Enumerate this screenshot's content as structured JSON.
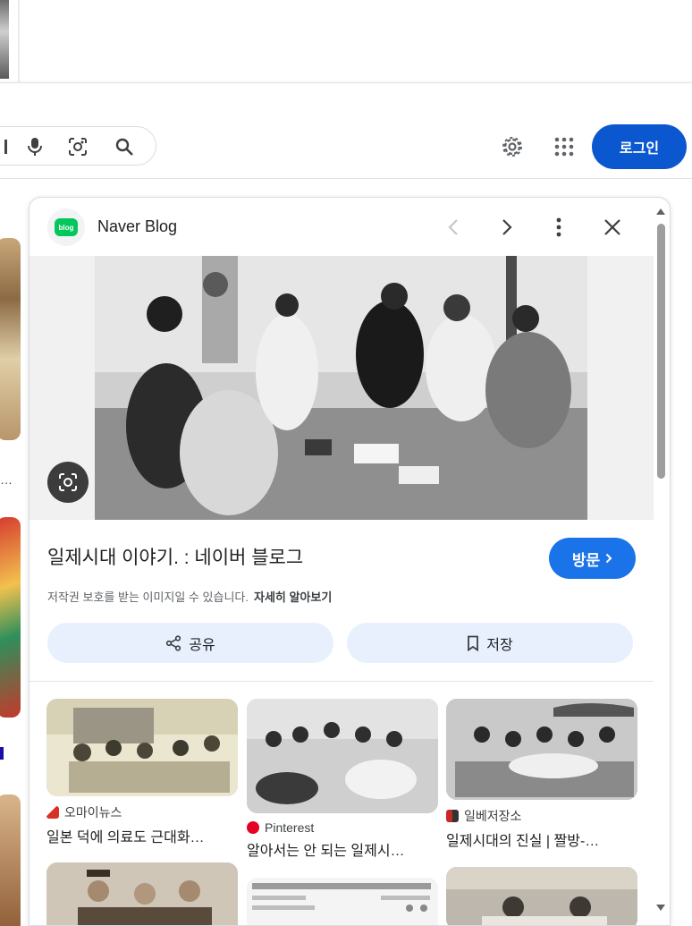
{
  "header": {
    "login_label": "로그인"
  },
  "panel": {
    "source_name": "Naver Blog",
    "source_logo_text": "blog",
    "title": "일제시대 이야기. : 네이버 블로그",
    "visit_label": "방문",
    "copyright_notice": "저작권 보호를 받는 이미지일 수 있습니다.",
    "learn_more": "자세히 알아보기",
    "share_label": "공유",
    "save_label": "저장"
  },
  "left_column": {
    "ellipsis": "…"
  },
  "related": [
    {
      "source": "오마이뉴스",
      "title": "일본 덕에 의료도 근대화…"
    },
    {
      "source": "Pinterest",
      "title": "알아서는 안 되는 일제시…"
    },
    {
      "source": "일베저장소",
      "title": "일제시대의 진실 | 짤방-…"
    }
  ],
  "colors": {
    "accent": "#0b57d0",
    "visit": "#1a73e8",
    "action_bg": "#e8f0fe",
    "naver_green": "#03c75a"
  }
}
